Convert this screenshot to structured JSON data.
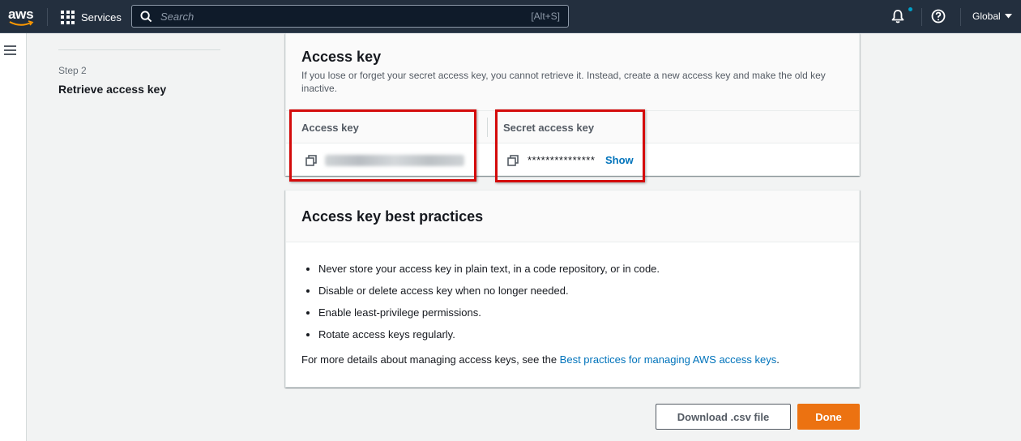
{
  "nav": {
    "logo": "aws",
    "services_label": "Services",
    "search_placeholder": "Search",
    "search_shortcut": "[Alt+S]",
    "region_label": "Global",
    "icons": [
      "aws-logo",
      "services-grid-icon",
      "search-icon",
      "bell-icon",
      "help-icon",
      "chevron-down-icon",
      "hamburger-icon"
    ]
  },
  "steps": {
    "step_number": "Step 2",
    "step_title": "Retrieve access key"
  },
  "access_key_card": {
    "title": "Access key",
    "description": "If you lose or forget your secret access key, you cannot retrieve it. Instead, create a new access key and make the old key inactive.",
    "col_access_key": "Access key",
    "col_secret_key": "Secret access key",
    "secret_masked": "***************",
    "show_label": "Show"
  },
  "best_practices": {
    "title": "Access key best practices",
    "items": [
      "Never store your access key in plain text, in a code repository, or in code.",
      "Disable or delete access key when no longer needed.",
      "Enable least-privilege permissions.",
      "Rotate access keys regularly."
    ],
    "more_prefix": "For more details about managing access keys, see the ",
    "more_link": "Best practices for managing AWS access keys",
    "more_suffix": "."
  },
  "actions": {
    "download_label": "Download .csv file",
    "done_label": "Done"
  },
  "colors": {
    "nav_bg": "#232f3e",
    "link": "#0073bb",
    "primary_button": "#ec7211",
    "highlight": "#d40b0b"
  }
}
